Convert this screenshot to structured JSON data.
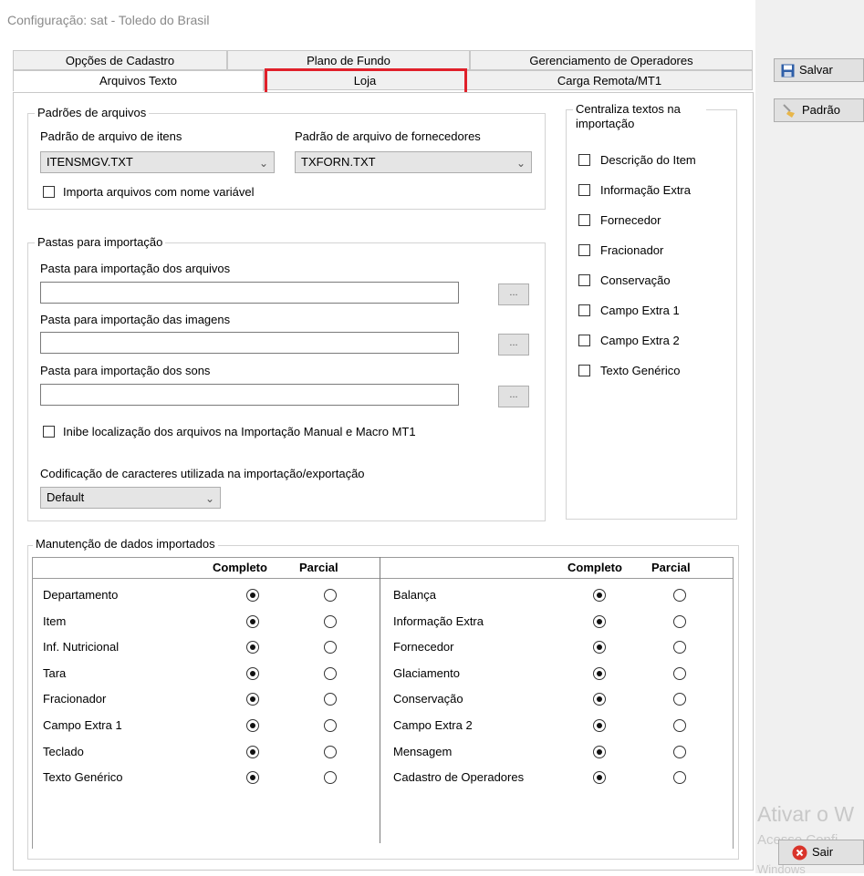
{
  "window": {
    "title": "Configuração: sat - Toledo do Brasil"
  },
  "tabs_row1": [
    {
      "label": "Opções de Cadastro"
    },
    {
      "label": "Plano de Fundo"
    },
    {
      "label": "Gerenciamento de Operadores"
    }
  ],
  "tabs_row2": [
    {
      "label": "Arquivos Texto"
    },
    {
      "label": "Loja"
    },
    {
      "label": "Carga Remota/MT1"
    }
  ],
  "padroes": {
    "legend": "Padrões de arquivos",
    "itens_label": "Padrão de arquivo de itens",
    "itens_value": "ITENSMGV.TXT",
    "fornecedores_label": "Padrão de arquivo de fornecedores",
    "fornecedores_value": "TXFORN.TXT",
    "importa_label": "Importa arquivos com nome variável"
  },
  "pastas": {
    "legend": "Pastas para importação",
    "arquivos_label": "Pasta para importação dos arquivos",
    "imagens_label": "Pasta para importação das imagens",
    "sons_label": "Pasta para importação dos sons",
    "browse_label": "...",
    "inibe_label": "Inibe localização dos arquivos na Importação Manual e Macro MT1",
    "codificacao_label": "Codificação de caracteres utilizada na importação/exportação",
    "codificacao_value": "Default"
  },
  "centraliza": {
    "legend": "Centraliza textos na importação",
    "items": [
      "Descrição do Item",
      "Informação Extra",
      "Fornecedor",
      "Fracionador",
      "Conservação",
      "Campo Extra 1",
      "Campo Extra 2",
      "Texto Genérico"
    ]
  },
  "manutencao": {
    "legend": "Manutenção de dados importados",
    "col_completo": "Completo",
    "col_parcial": "Parcial",
    "left_rows": [
      "Departamento",
      "Item",
      "Inf. Nutricional",
      "Tara",
      "Fracionador",
      "Campo Extra 1",
      "Teclado",
      "Texto Genérico"
    ],
    "right_rows": [
      "Balança",
      "Informação Extra",
      "Fornecedor",
      "Glaciamento",
      "Conservação",
      "Campo Extra 2",
      "Mensagem",
      "Cadastro de Operadores"
    ]
  },
  "buttons": {
    "salvar": "Salvar",
    "padrao": "Padrão",
    "sair": "Sair"
  },
  "watermark": {
    "line1": "Ativar o W",
    "line2": "Acesse Confi",
    "line3": "Windows"
  },
  "colors": {
    "highlight": "#e0202a",
    "save_icon": "#2f5fa8",
    "exit_icon": "#d9342b"
  }
}
